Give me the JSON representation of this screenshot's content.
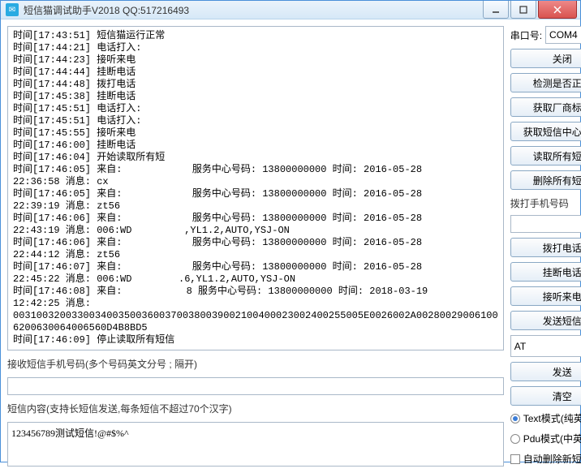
{
  "window": {
    "title": "短信猫调试助手V2018   QQ:517216493"
  },
  "log_lines": [
    "时间[17:43:51] 短信猫运行正常",
    "时间[17:44:21] 电话打入:",
    "时间[17:44:23] 接听来电",
    "时间[17:44:44] 挂断电话",
    "时间[17:44:48] 拨打电话",
    "时间[17:45:38] 挂断电话",
    "时间[17:45:51] 电话打入:",
    "时间[17:45:51] 电话打入:",
    "时间[17:45:55] 接听来电",
    "时间[17:46:00] 挂断电话",
    "时间[17:46:04] 开始读取所有短",
    "时间[17:46:05] 来自:            服务中心号码: 13800000000 时间: 2016-05-28",
    "22:36:58 消息: cx",
    "时间[17:46:05] 来自:            服务中心号码: 13800000000 时间: 2016-05-28",
    "22:39:19 消息: zt56",
    "时间[17:46:06] 来自:            服务中心号码: 13800000000 时间: 2016-05-28",
    "22:43:19 消息: 006:WD         ,YL1.2,AUTO,YSJ-ON",
    "时间[17:46:06] 来自:            服务中心号码: 13800000000 时间: 2016-05-28",
    "22:44:12 消息: zt56",
    "时间[17:46:07] 来自:            服务中心号码: 13800000000 时间: 2016-05-28",
    "22:45:22 消息: 006:WD        .6,YL1.2,AUTO,YSJ-ON",
    "时间[17:46:08] 来自:           8 服务中心号码: 13800000000 时间: 2018-03-19",
    "12:42:25 消息:",
    "003100320033003400350036003700380039002100400023002400255005E0026002A00280029006100",
    "6200630064006560D4B8BD5",
    "时间[17:46:09] 停止读取所有短信"
  ],
  "left": {
    "recv_label": "接收短信手机号码(多个号码英文分号 ; 隔开)",
    "recv_value": "",
    "content_label": "短信内容(支持长短信发送,每条短信不超过70个汉字)",
    "content_value": "123456789测试短信!@#$%^"
  },
  "right": {
    "port_label": "串口号:",
    "port_value": "COM4",
    "btn_close": "关闭",
    "btn_check": "检测是否正常",
    "btn_vendor": "获取厂商标识",
    "btn_smsc": "获取短信中心号码",
    "btn_readall": "读取所有短信",
    "btn_delall": "删除所有短信",
    "dial_label": "拨打手机号码",
    "dial_value": "",
    "btn_dial": "拨打电话",
    "btn_hang": "挂断电话",
    "btn_answer": "接听来电",
    "btn_sendsms": "发送短信",
    "cmd_value": "AT",
    "btn_send": "发送",
    "btn_clear": "清空",
    "radio_text": "Text模式(纯英文)",
    "radio_pdu": "Pdu模式(中英文)",
    "chk_autodel": "自动删除新短信",
    "mode": "text",
    "autodel": false
  }
}
